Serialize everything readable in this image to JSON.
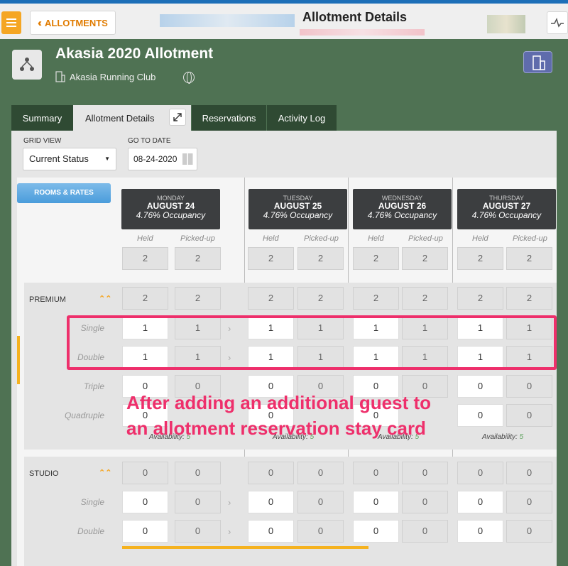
{
  "topbar": {
    "back_label": "ALLOTMENTS",
    "title": "Allotment Details"
  },
  "allotment": {
    "name": "Akasia 2020 Allotment",
    "club": "Akasia Running Club"
  },
  "tabs": [
    "Summary",
    "Allotment Details",
    "Reservations",
    "Activity Log"
  ],
  "controls": {
    "grid_view_label": "GRID VIEW",
    "grid_view_value": "Current Status",
    "goto_label": "GO TO DATE",
    "date_value": "08-24-2020"
  },
  "rooms_rates_label": "ROOMS & RATES",
  "days": [
    {
      "name": "MONDAY",
      "date": "AUGUST 24",
      "occupancy": "4.76% Occupancy"
    },
    {
      "name": "TUESDAY",
      "date": "AUGUST 25",
      "occupancy": "4.76% Occupancy"
    },
    {
      "name": "WEDNESDAY",
      "date": "AUGUST 26",
      "occupancy": "4.76% Occupancy"
    },
    {
      "name": "THURSDAY",
      "date": "AUGUST 27",
      "occupancy": "4.76% Occupancy"
    }
  ],
  "col_labels": {
    "held": "Held",
    "picked": "Picked-up"
  },
  "totals": [
    "2",
    "2",
    "2",
    "2",
    "2",
    "2",
    "2",
    "2"
  ],
  "premium": {
    "name": "PREMIUM",
    "total": [
      "2",
      "2",
      "2",
      "2",
      "2",
      "2",
      "2",
      "2"
    ],
    "rows": [
      {
        "label": "Single",
        "values": [
          "1",
          "1",
          "1",
          "1",
          "1",
          "1",
          "1",
          "1"
        ]
      },
      {
        "label": "Double",
        "values": [
          "1",
          "1",
          "1",
          "1",
          "1",
          "1",
          "1",
          "1"
        ]
      },
      {
        "label": "Triple",
        "values": [
          "0",
          "0",
          "0",
          "0",
          "0",
          "0",
          "0",
          "0"
        ]
      },
      {
        "label": "Quadruple",
        "values": [
          "0",
          "0",
          "0",
          "0",
          "0",
          "0",
          "0",
          "0"
        ]
      }
    ],
    "availability_label": "Availability:",
    "availability_value": "5"
  },
  "studio": {
    "name": "STUDIO",
    "total": [
      "0",
      "0",
      "0",
      "0",
      "0",
      "0",
      "0",
      "0"
    ],
    "rows": [
      {
        "label": "Single",
        "values": [
          "0",
          "0",
          "0",
          "0",
          "0",
          "0",
          "0",
          "0"
        ]
      },
      {
        "label": "Double",
        "values": [
          "0",
          "0",
          "0",
          "0",
          "0",
          "0",
          "0",
          "0"
        ]
      }
    ]
  },
  "annotation": {
    "line1": "After adding an additional guest to",
    "line2": "an allotment reservation stay card"
  },
  "colors": {
    "accent": "#f5a623",
    "highlight": "#ee2f6b",
    "background": "#4f7253"
  }
}
